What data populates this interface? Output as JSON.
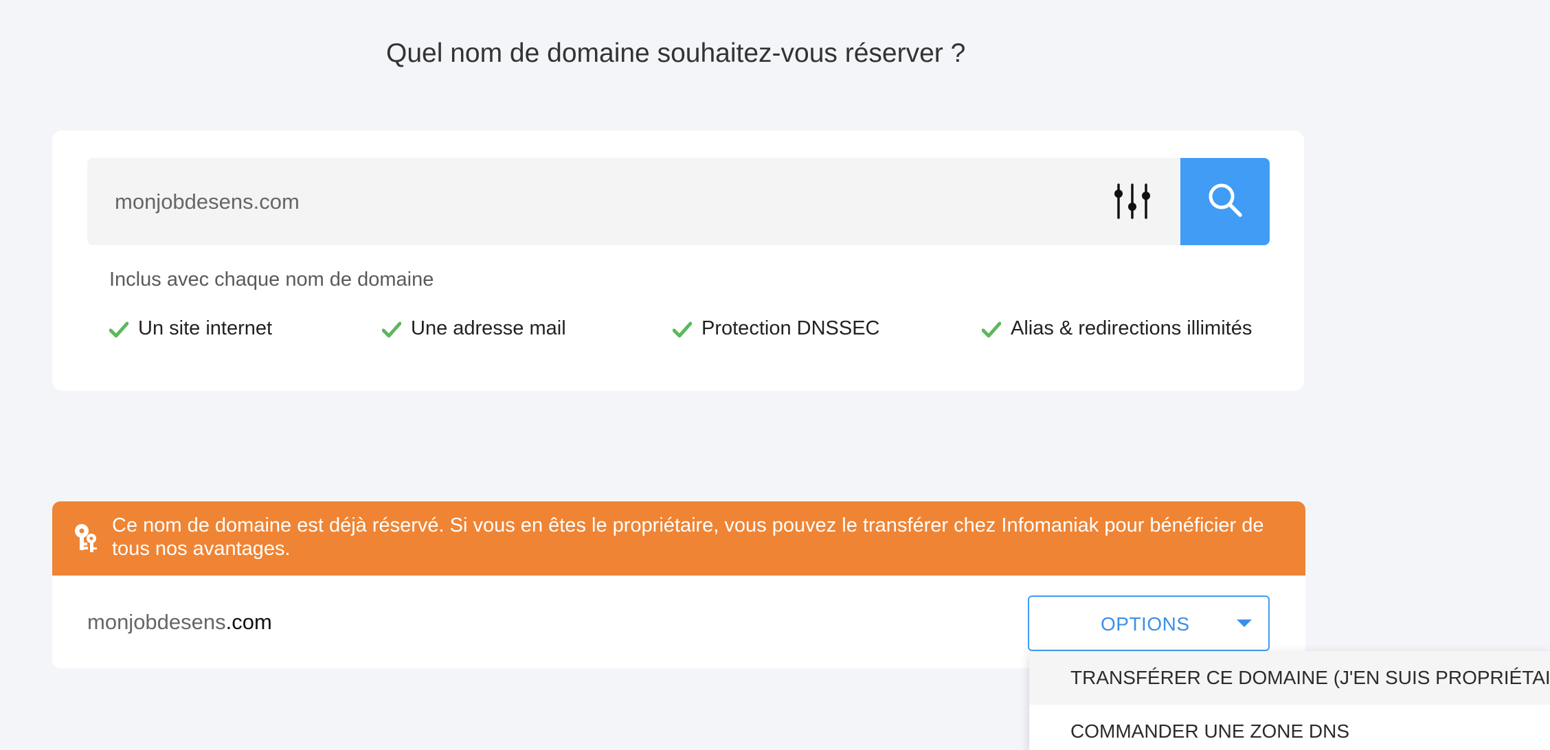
{
  "heading": "Quel nom de domaine souhaitez-vous réserver ?",
  "search": {
    "value": "monjobdesens.com",
    "filter_icon": "sliders-icon",
    "button_icon": "search-icon"
  },
  "included": {
    "label": "Inclus avec chaque nom de domaine",
    "features": [
      "Un site internet",
      "Une adresse mail",
      "Protection DNSSEC",
      "Alias & redirections illimités"
    ],
    "check_icon": "check-icon"
  },
  "alert": {
    "icon": "keys-icon",
    "text": "Ce nom de domaine est déjà réservé. Si vous en êtes le propriétaire, vous pouvez le transférer chez Infomaniak pour bénéficier de tous nos avantages."
  },
  "result": {
    "domain_sld": "monjobdesens",
    "domain_tld": ".com",
    "options_label": "OPTIONS"
  },
  "menu": {
    "items": [
      "TRANSFÉRER CE DOMAINE (J'EN SUIS PROPRIÉTAIRE)",
      "COMMANDER UNE ZONE DNS"
    ]
  },
  "colors": {
    "page_bg": "#f4f5f9",
    "accent_blue": "#409cf5",
    "alert_orange": "#ef8434",
    "check_green": "#5cb85c"
  }
}
